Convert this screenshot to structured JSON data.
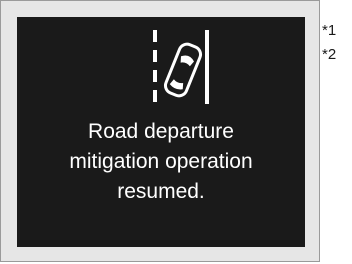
{
  "display": {
    "icon": "road-departure-car-icon",
    "message_lines": [
      "Road departure",
      "mitigation operation",
      "resumed."
    ]
  },
  "footnotes": [
    "*1",
    "*2"
  ],
  "colors": {
    "frame_background": "#e6e6e6",
    "screen_background": "#1a1a1a",
    "text": "#ffffff"
  }
}
